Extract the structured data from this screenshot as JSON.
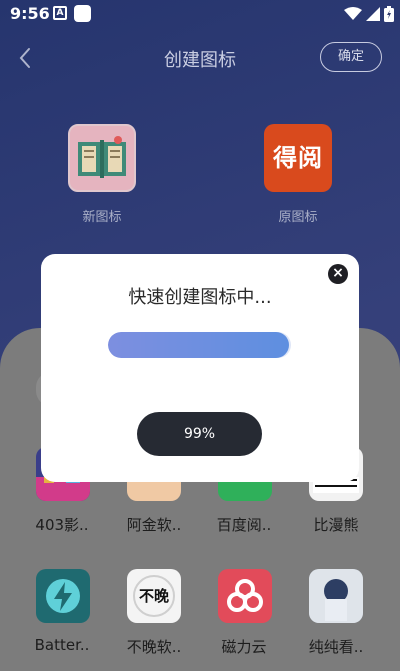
{
  "status_bar": {
    "time": "9:56",
    "a_badge": "A"
  },
  "header": {
    "title": "创建图标",
    "confirm_label": "确定"
  },
  "icons": {
    "new_label": "新图标",
    "original_label": "原图标",
    "original_icon_text": "得阅"
  },
  "dialog": {
    "title": "快速创建图标中...",
    "progress": 0.99,
    "percent_text": "99%"
  },
  "apps_row1": [
    {
      "label": "403影..",
      "icon": "403-app-icon",
      "color": "#3a3e8a"
    },
    {
      "label": "阿金软..",
      "icon": "ajin-app-icon",
      "color": "#f0c9a4"
    },
    {
      "label": "百度阅..",
      "icon": "baidu-read-icon",
      "color": "#2fb05a"
    },
    {
      "label": "比漫熊",
      "icon": "bimanxiong-icon",
      "color": "#f2f2f2"
    }
  ],
  "apps_row2": [
    {
      "label": "Batter..",
      "icon": "battery-app-icon",
      "color": "#1f6a70"
    },
    {
      "label": "不晚软..",
      "icon": "buwan-app-icon",
      "color": "#f4f4f4",
      "icon_text": "不晚"
    },
    {
      "label": "磁力云",
      "icon": "cili-cloud-icon",
      "color": "#e24b5a"
    },
    {
      "label": "纯纯看..",
      "icon": "chunchun-app-icon",
      "color": "#9aa8b8"
    }
  ]
}
